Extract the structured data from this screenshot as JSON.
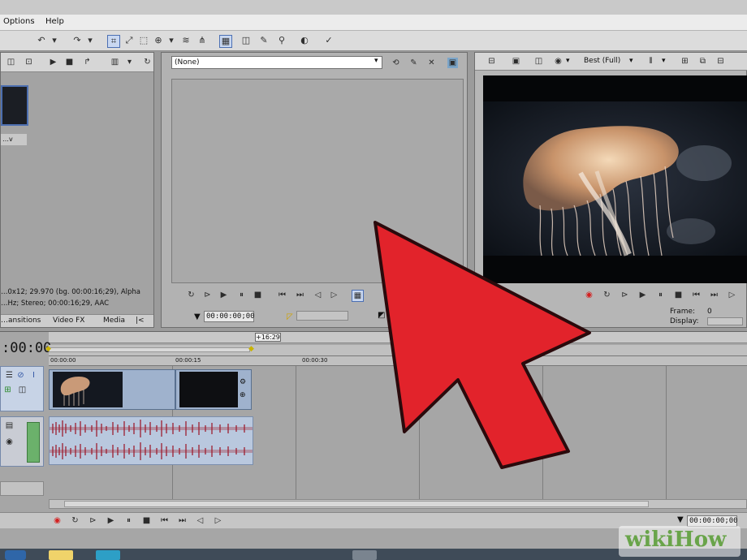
{
  "menu": {
    "options": "Options",
    "help": "Help"
  },
  "colors": {
    "accent": "#e11d2b",
    "selection": "#c9d8f1",
    "arrow": "#e2232b"
  },
  "trimmer": {
    "media_select": "(None)"
  },
  "preview": {
    "quality_select": "Best (Full)",
    "frame_label": "Frame:",
    "frame_value": "0",
    "display_label": "Display:"
  },
  "left_panel": {
    "tabs": [
      "…ansitions",
      "Video FX",
      "Media",
      "|<"
    ],
    "info1": "…0x12; 29.970 (bg. 00:00:16;29), Alpha",
    "info2": "…Hz; Stereo; 00:00:16;29, AAC",
    "thumb_label": "…v"
  },
  "timecodes": {
    "trimmer_time": "00:00:00;00",
    "timeline_cursor": ":00:00",
    "marker": "+16:29",
    "bottom_time": "00:00:00;00",
    "ruler_start": "00:00:00",
    "ruler_mark": "00:00:15",
    "ruler_mark2": "00:00:30"
  },
  "icons": {
    "timeline_track_count": 2
  },
  "watermark": "wikiHow"
}
